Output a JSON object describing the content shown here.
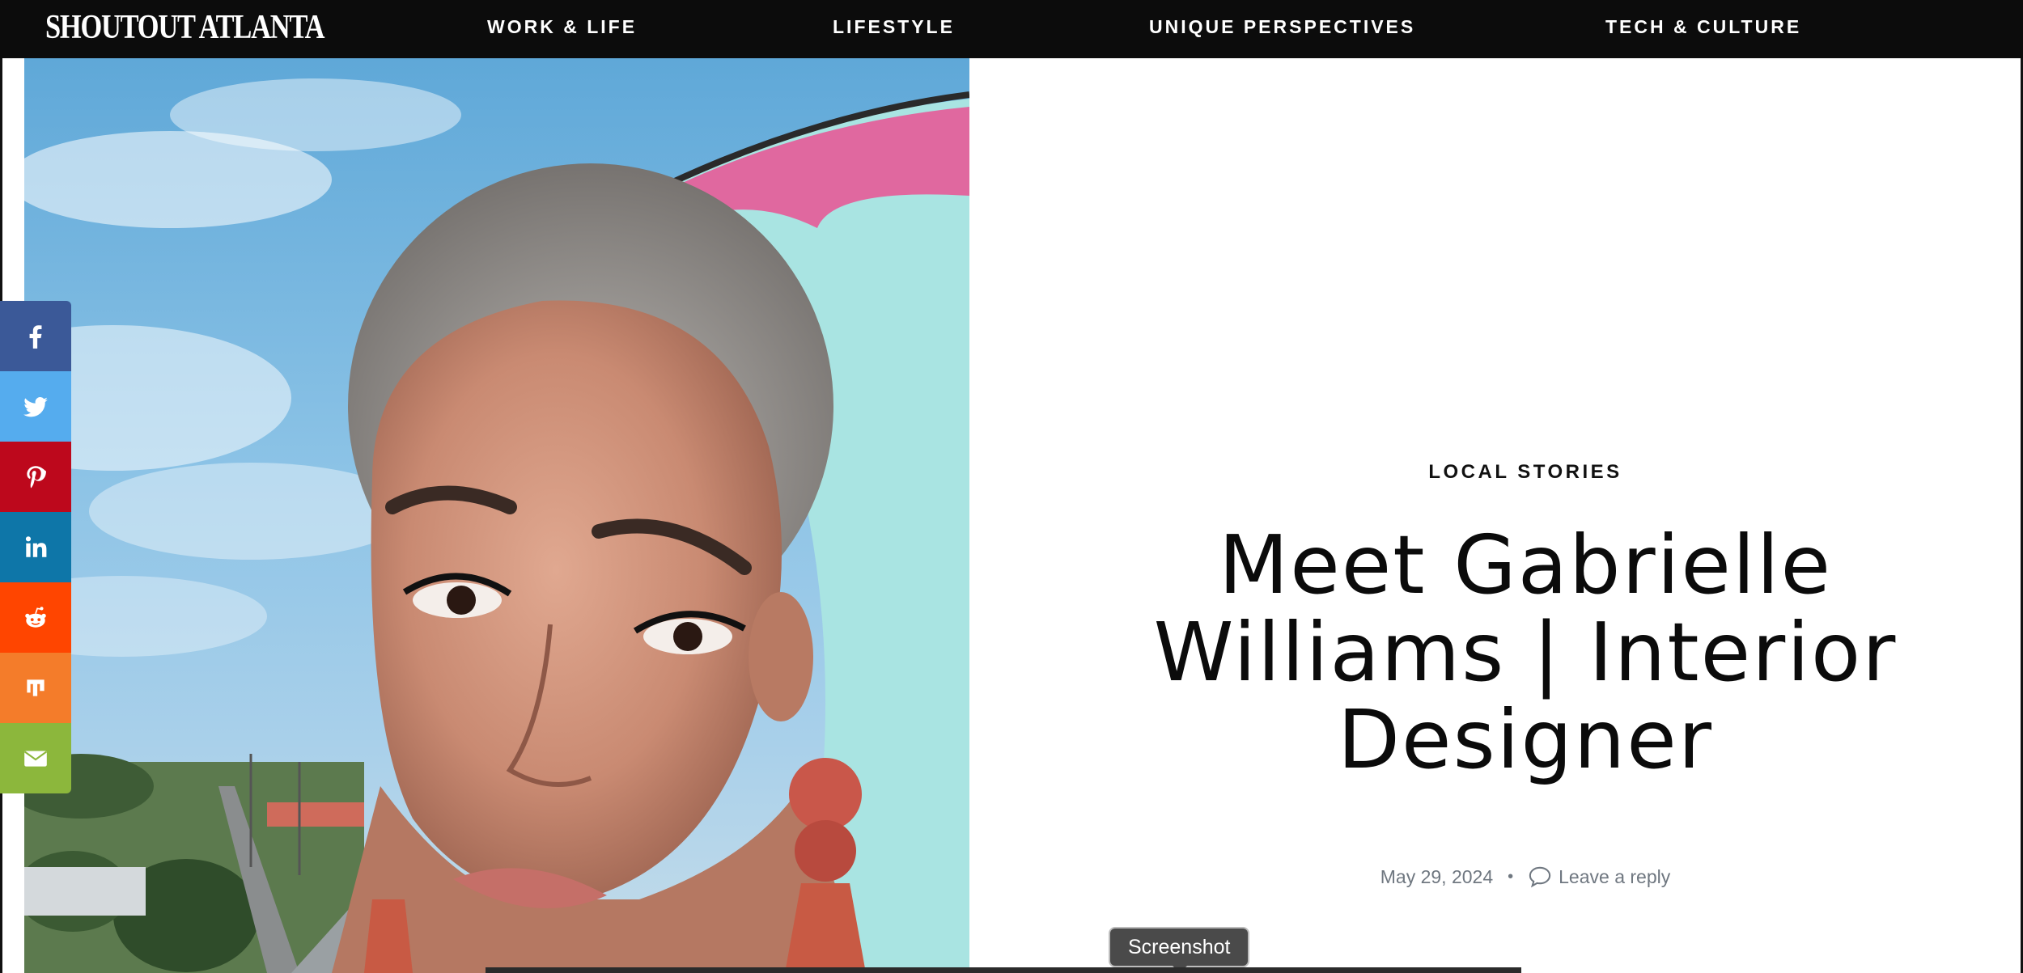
{
  "header": {
    "logo_text": "SHOUTOUT ATLANTA",
    "nav": [
      {
        "label": "WORK & LIFE"
      },
      {
        "label": "LIFESTYLE"
      },
      {
        "label": "UNIQUE PERSPECTIVES"
      },
      {
        "label": "TECH & CULTURE"
      }
    ]
  },
  "share_bar": {
    "buttons": [
      {
        "network": "facebook",
        "icon": "facebook-icon",
        "color": "#3b5998"
      },
      {
        "network": "twitter",
        "icon": "twitter-icon",
        "color": "#55acee"
      },
      {
        "network": "pinterest",
        "icon": "pinterest-icon",
        "color": "#bd081c"
      },
      {
        "network": "linkedin",
        "icon": "linkedin-icon",
        "color": "#0e76a8"
      },
      {
        "network": "reddit",
        "icon": "reddit-icon",
        "color": "#ff4500"
      },
      {
        "network": "mix",
        "icon": "mix-icon",
        "color": "#f47c2a"
      },
      {
        "network": "email",
        "icon": "email-icon",
        "color": "#8cb73c"
      }
    ]
  },
  "article": {
    "category": "LOCAL STORIES",
    "title_lines": [
      "Meet Gabrielle",
      "Williams | Interior",
      "Designer"
    ],
    "date": "May 29, 2024",
    "separator": "•",
    "reply_label": "Leave a reply"
  },
  "tooltip": {
    "label": "Screenshot"
  }
}
